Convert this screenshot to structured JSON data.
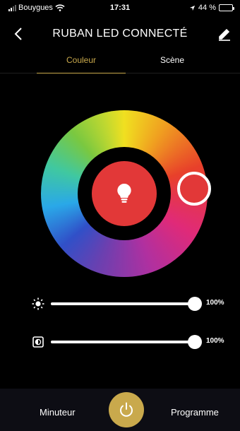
{
  "status_bar": {
    "carrier": "Bouygues",
    "time": "17:31",
    "battery_percent": "44 %",
    "battery_level": 0.44
  },
  "nav": {
    "title": "RUBAN LED CONNECTÉ",
    "back_icon": "chevron-left-icon",
    "edit_icon": "pencil-icon"
  },
  "tabs": [
    {
      "label": "Couleur",
      "active": true
    },
    {
      "label": "Scène",
      "active": false
    }
  ],
  "color_wheel": {
    "selected_color": "#e23838",
    "center_icon": "lightbulb-icon"
  },
  "sliders": {
    "brightness": {
      "icon": "sun-icon",
      "value": 100,
      "value_label": "100%"
    },
    "contrast": {
      "icon": "contrast-icon",
      "value": 100,
      "value_label": "100%"
    }
  },
  "bottom_bar": {
    "timer_label": "Minuteur",
    "program_label": "Programme",
    "power_icon": "power-icon"
  },
  "colors": {
    "accent": "#c9a94c",
    "background": "#000000",
    "selected_color": "#e23838"
  }
}
